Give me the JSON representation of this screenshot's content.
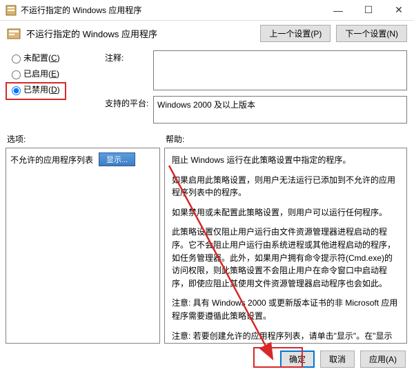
{
  "window": {
    "title": "不运行指定的 Windows 应用程序",
    "header_title": "不运行指定的 Windows 应用程序",
    "prev_setting": "上一个设置(P)",
    "next_setting": "下一个设置(N)",
    "minimize": "—",
    "maximize": "☐",
    "close": "✕"
  },
  "radios": {
    "not_configured": "未配置(",
    "not_configured_hk": "C",
    "enabled": "已启用(",
    "enabled_hk": "E",
    "disabled": "已禁用(",
    "disabled_hk": "D",
    "close_paren": ")"
  },
  "fields": {
    "comment_label": "注释:",
    "comment_value": "",
    "platform_label": "支持的平台:",
    "platform_value": "Windows 2000 及以上版本"
  },
  "labels": {
    "options": "选项:",
    "help": "帮助:"
  },
  "options": {
    "list_label": "不允许的应用程序列表",
    "show_btn": "显示..."
  },
  "help": {
    "p1": "阻止 Windows 运行在此策略设置中指定的程序。",
    "p2": "如果启用此策略设置，则用户无法运行已添加到不允许的应用程序列表中的程序。",
    "p3": "如果禁用或未配置此策略设置，则用户可以运行任何程序。",
    "p4": "此策略设置仅阻止用户运行由文件资源管理器进程启动的程序。它不会阻止用户运行由系统进程或其他进程启动的程序，如任务管理器。此外，如果用户拥有命令提示符(Cmd.exe)的访问权限，则此策略设置不会阻止用户在命令窗口中启动程序，即使应阻止其使用文件资源管理器启动程序也会如此。",
    "p5": "注意: 具有 Windows 2000 或更新版本证书的非 Microsoft 应用程序需要遵循此策略设置。",
    "p6": "注意: 若要创建允许的应用程序列表，请单击\"显示\"。在\"显示内容\"对话框的\"值\"列中，键入应用程序可执行文件名(例如，Winword.exe、Poledit.exe 和 Powerpnt.exe)。"
  },
  "buttons": {
    "ok": "确定",
    "cancel": "取消",
    "apply": "应用(A)"
  }
}
